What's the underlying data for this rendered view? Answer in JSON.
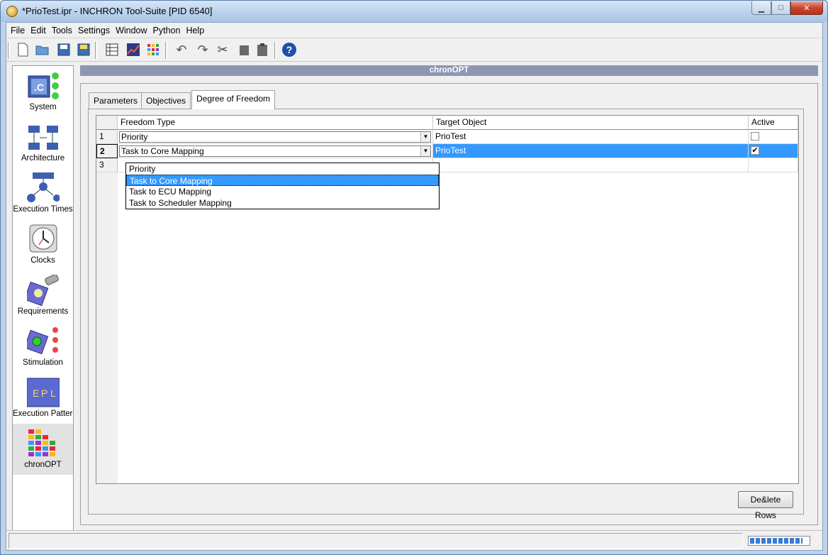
{
  "window": {
    "title": "*PrioTest.ipr - INCHRON Tool-Suite [PID 6540]"
  },
  "menu": [
    "File",
    "Edit",
    "Tools",
    "Settings",
    "Window",
    "Python",
    "Help"
  ],
  "sidebar": {
    "items": [
      {
        "label": "System"
      },
      {
        "label": "Architecture"
      },
      {
        "label": "Execution Times"
      },
      {
        "label": "Clocks"
      },
      {
        "label": "Requirements"
      },
      {
        "label": "Stimulation"
      },
      {
        "label": "Execution Pattern"
      },
      {
        "label": "chronOPT"
      }
    ]
  },
  "panel": {
    "title": "chronOPT"
  },
  "tabs": [
    "Parameters",
    "Objectives",
    "Degree of Freedom"
  ],
  "grid": {
    "headers": [
      "Freedom Type",
      "Target Object",
      "Active"
    ],
    "rows": [
      {
        "num": "1",
        "type": "Priority",
        "target": "PrioTest",
        "active": false
      },
      {
        "num": "2",
        "type": "Task to Core Mapping",
        "target": "PrioTest",
        "active": true
      },
      {
        "num": "3",
        "type": "",
        "target": "",
        "active": false
      }
    ]
  },
  "dropdown": {
    "options": [
      "Priority",
      "Task to Core Mapping",
      "Task to ECU Mapping",
      "Task to Scheduler Mapping"
    ],
    "highlighted": "Task to Core Mapping"
  },
  "buttons": {
    "delete_rows": "De&lete Rows"
  },
  "progress": 0.9,
  "icons": {
    "help": "help-icon",
    "undo": "undo-icon",
    "redo": "redo-icon",
    "cut": "cut-icon"
  }
}
